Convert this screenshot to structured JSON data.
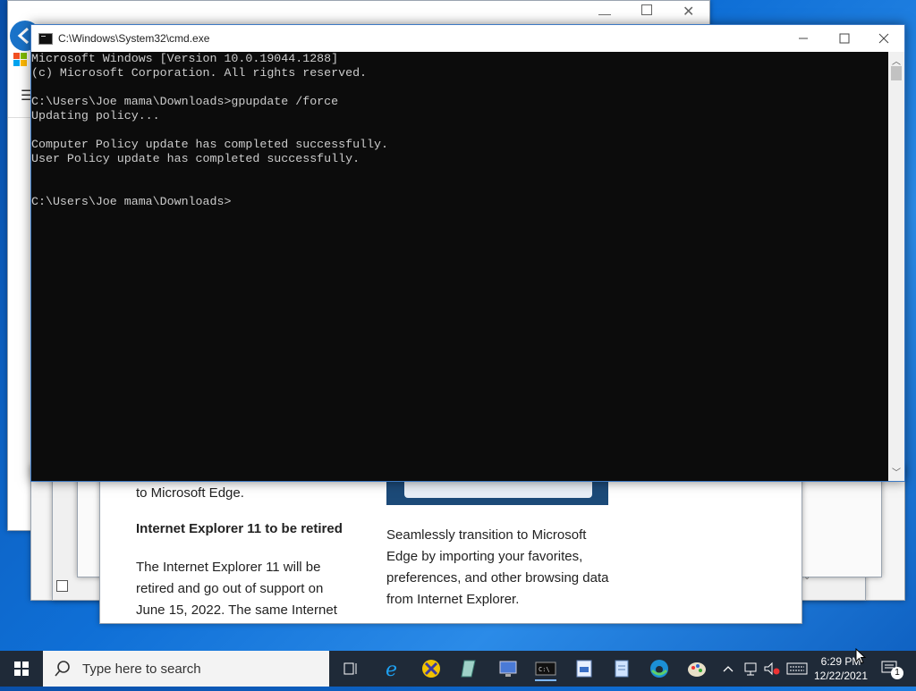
{
  "cmd": {
    "title": "C:\\Windows\\System32\\cmd.exe",
    "lines": [
      "Microsoft Windows [Version 10.0.19044.1288]",
      "(c) Microsoft Corporation. All rights reserved.",
      "",
      "C:\\Users\\Joe mama\\Downloads>gpupdate /force",
      "Updating policy...",
      "",
      "Computer Policy update has completed successfully.",
      "User Policy update has completed successfully.",
      "",
      "",
      "C:\\Users\\Joe mama\\Downloads>"
    ]
  },
  "edge_page": {
    "left_top_fragment": "to Microsoft Edge.",
    "heading": "Internet Explorer 11 to be retired",
    "body": "The Internet Explorer 11 will be retired and go out of support on June 15, 2022. The same Internet",
    "right_body": "Seamlessly transition to Microsoft Edge by importing your favorites, preferences, and other browsing data from Internet Explorer."
  },
  "taskbar": {
    "search_placeholder": "Type here to search",
    "clock_time": "6:29 PM",
    "clock_date": "12/22/2021",
    "notification_count": "1"
  },
  "colors": {
    "console_bg": "#0c0c0c",
    "console_text": "#cccccc",
    "taskbar_bg": "#1f2a38",
    "desktop_blue": "#0f6fd6"
  }
}
